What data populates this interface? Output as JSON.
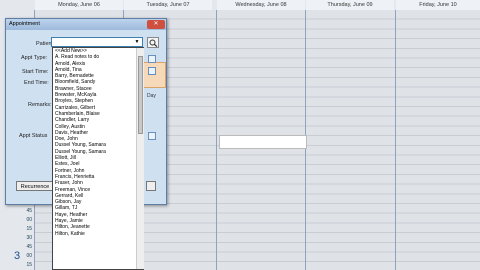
{
  "calendar": {
    "days": [
      "Monday, June 06",
      "Tuesday, June 07",
      "Wednesday, June 08",
      "Thursday, June 09",
      "Friday, June 10"
    ],
    "time_rows": [
      "30",
      "45",
      "00",
      "15",
      "30",
      "45",
      "00",
      "15"
    ],
    "hour_label": "3"
  },
  "dialog": {
    "title": "Appointment",
    "close_label": "✕",
    "labels": {
      "patient": "Patient:",
      "appt_type": "Appt Type:",
      "start_time": "Start Time:",
      "end_time": "End Time:",
      "remarks": "Remarks:",
      "appt_status": "Appt Status"
    },
    "patient_value": "",
    "day_label": "Day",
    "recurrence_label": "Recurrence",
    "dropdown_items": [
      "<<Add New>>",
      "A. Read notes to do",
      "Arnold, Alexis",
      "Arnold, Tina",
      "Barry, Bernadette",
      "Bloomfield, Sandy",
      "Brawner, Stacee",
      "Brewster, McKayla",
      "Broyles, Stephen",
      "Carrizales, Gilbert",
      "Chamberlain, Blaise",
      "Chandler, Larry",
      "Colley, Austin",
      "Davis, Heather",
      "Doe, John",
      "Dussel Young, Samara",
      "Dussel Young, Samara",
      "Elliott, Jill",
      "Estes, Joel",
      "Fortner, John",
      "Francis, Henrietta",
      "Fraser, John",
      "Freeman, Vince",
      "Gerrard, Kell",
      "Gibson, Jay",
      "Gillam, TJ",
      "Haye, Heather",
      "Haye, Jamie",
      "Hilton, Jeanette",
      "Hilton, Kathie"
    ]
  }
}
